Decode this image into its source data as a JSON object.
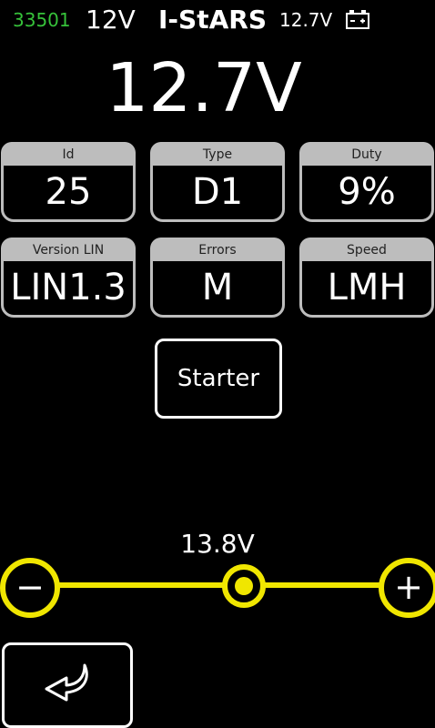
{
  "status": {
    "code": "33501",
    "code_color": "#36c13a",
    "system_voltage": "12V",
    "brand": "I-StARS",
    "battery_voltage": "12.7V",
    "battery_icon": "battery-icon"
  },
  "main_voltage": "12.7V",
  "tiles": [
    {
      "label": "Id",
      "value": "25"
    },
    {
      "label": "Type",
      "value": "D1"
    },
    {
      "label": "Duty",
      "value": "9%"
    },
    {
      "label": "Version LIN",
      "value": "LIN1.3"
    },
    {
      "label": "Errors",
      "value": "M"
    },
    {
      "label": "Speed",
      "value": "LMH"
    }
  ],
  "starter_button": "Starter",
  "setpoint": {
    "label": "13.8V",
    "minus": "−",
    "plus": "+",
    "accent_color": "#f0e600"
  },
  "back_button_icon": "back-arrow-icon"
}
